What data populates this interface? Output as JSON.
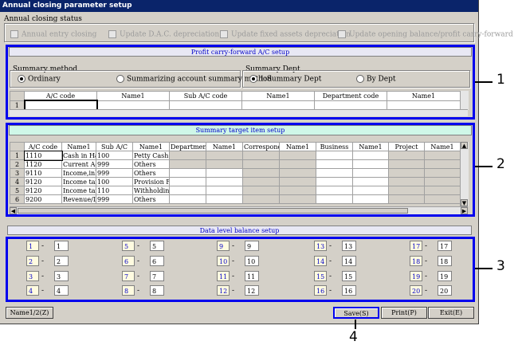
{
  "window": {
    "title": "Annual closing parameter setup"
  },
  "closing_status": {
    "label": "Annual closing status",
    "items": [
      "Annual entry closing",
      "Update D.A.C. depreciation",
      "Update fixed assets depreciation",
      "Update opening balance/profit carry-forward"
    ]
  },
  "profit_section": {
    "header": "Profit carry-forward A/C setup",
    "summary_method": {
      "label": "Summary method",
      "options": [
        "Ordinary",
        "Summarizing account summary method"
      ],
      "selected": 0
    },
    "summary_dept": {
      "label": "Summary Dept",
      "options": [
        "1:Summary Dept",
        "By Dept"
      ],
      "selected": 0
    },
    "columns": [
      "A/C code",
      "Name1",
      "Sub A/C code",
      "Name1",
      "Department code",
      "Name1"
    ],
    "rows": [
      {
        "num": "1"
      }
    ]
  },
  "target_section": {
    "header": "Summary target item setup",
    "columns": [
      "A/C code",
      "Name1",
      "Sub A/C",
      "Name1",
      "Department",
      "Name1",
      "Correspond",
      "Name1",
      "Business",
      "Name1",
      "Project",
      "Name1"
    ],
    "rows": [
      {
        "num": "1",
        "code": "1110",
        "name": "Cash in Hanc",
        "sub": "100",
        "subname": "Petty Cash"
      },
      {
        "num": "2",
        "code": "1120",
        "name": "Current Acco",
        "sub": "999",
        "subname": "Others"
      },
      {
        "num": "3",
        "code": "9110",
        "name": "Income,inhab",
        "sub": "999",
        "subname": "Others"
      },
      {
        "num": "4",
        "code": "9120",
        "name": "Income taxes",
        "sub": "100",
        "subname": "Provision Fo"
      },
      {
        "num": "5",
        "code": "9120",
        "name": "Income taxes",
        "sub": "110",
        "subname": "Withholding"
      },
      {
        "num": "6",
        "code": "9200",
        "name": "Revenue/Los",
        "sub": "999",
        "subname": "Others"
      }
    ]
  },
  "balance_section": {
    "header": "Data level balance setup",
    "columns": [
      [
        [
          "1",
          "1"
        ],
        [
          "2",
          "2"
        ],
        [
          "3",
          "3"
        ],
        [
          "4",
          "4"
        ]
      ],
      [
        [
          "5",
          "5"
        ],
        [
          "6",
          "6"
        ],
        [
          "7",
          "7"
        ],
        [
          "8",
          "8"
        ]
      ],
      [
        [
          "9",
          "9"
        ],
        [
          "10",
          "10"
        ],
        [
          "11",
          "11"
        ],
        [
          "12",
          "12"
        ]
      ],
      [
        [
          "13",
          "13"
        ],
        [
          "14",
          "14"
        ],
        [
          "15",
          "15"
        ],
        [
          "16",
          "16"
        ]
      ],
      [
        [
          "17",
          "17"
        ],
        [
          "18",
          "18"
        ],
        [
          "19",
          "19"
        ],
        [
          "20",
          "20"
        ]
      ]
    ],
    "sep": "-"
  },
  "buttons": {
    "name": "Name1/2(Z)",
    "save": "Save(S)",
    "print": "Print(P)",
    "exit": "Exit(E)"
  },
  "callouts": [
    "1",
    "2",
    "3",
    "4"
  ]
}
